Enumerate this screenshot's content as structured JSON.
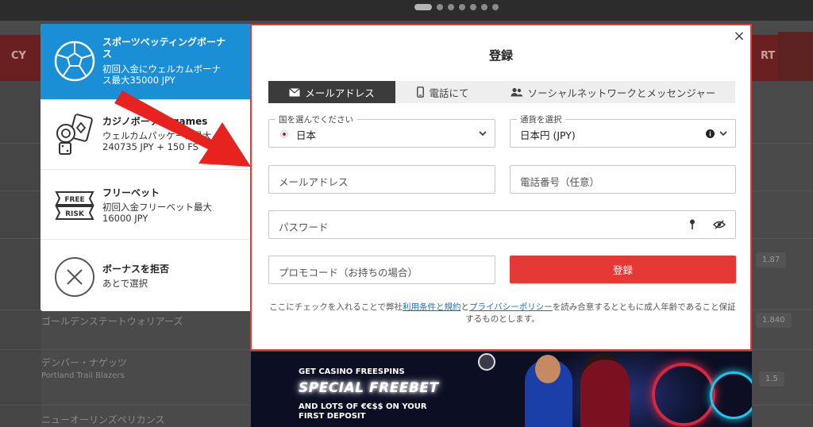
{
  "background": {
    "sports_label_left": "CY",
    "sports_label_right": "RT",
    "rows": [
      "ゴールデンステートウォリアーズ",
      "デンバー・ナゲッツ",
      "Portland Trail Blazers",
      "ニューオーリンズペリカンス"
    ],
    "odds": [
      "1.87",
      "1.840",
      "1.5"
    ]
  },
  "bonus_panel": {
    "items": [
      {
        "title": "スポーツベッティングボーナ\nス",
        "desc": "初回入金にウェルカムボーナ\nス最大35000 JPY",
        "icon": "soccer-ball-icon"
      },
      {
        "title": "カジノボーナス games",
        "desc": "ウェルカムパッケージ最大\n240735 JPY + 150 FS",
        "icon": "casino-chips-icon"
      },
      {
        "title": "フリーベット",
        "desc": "初回入金フリーベット最大\n16000 JPY",
        "icon": "free-risk-icon"
      },
      {
        "title": "ボーナスを拒否",
        "desc": "あとで選択",
        "icon": "decline-x-icon"
      }
    ],
    "free_icon_text": "FREE",
    "risk_icon_text": "RISK"
  },
  "modal": {
    "title": "登録",
    "close": "×",
    "tabs": [
      {
        "label": "メールアドレス",
        "icon": "envelope-icon"
      },
      {
        "label": "電話にて",
        "icon": "phone-icon"
      },
      {
        "label": "ソーシャルネットワークとメッセンジャー",
        "icon": "users-icon"
      }
    ],
    "country": {
      "label": "国を選んでください",
      "value": "日本"
    },
    "currency": {
      "label": "通貨を選択",
      "value": "日本円 (JPY)"
    },
    "email_placeholder": "メールアドレス",
    "phone_placeholder": "電話番号（任意）",
    "password_placeholder": "パスワード",
    "promo_placeholder": "プロモコード（お持ちの場合）",
    "submit_label": "登録",
    "terms_prefix": "ここにチェックを入れることで弊社",
    "terms_link1": "利用条件と規約",
    "terms_and": "と",
    "terms_link2": "プライバシーポリシー",
    "terms_suffix": "を読み合意するとともに成人年齢であること保証するものとします。"
  },
  "banner": {
    "line1": "GET CASINO FREESPINS",
    "line2": "SPECIAL FREEBET",
    "line3": "AND LOTS OF €€$$ ON YOUR\nFIRST DEPOSIT"
  },
  "colors": {
    "accent_red": "#e53935",
    "active_blue": "#1a8fd6",
    "tab_dark": "#3b3b3b",
    "link": "#1a6fbf"
  }
}
